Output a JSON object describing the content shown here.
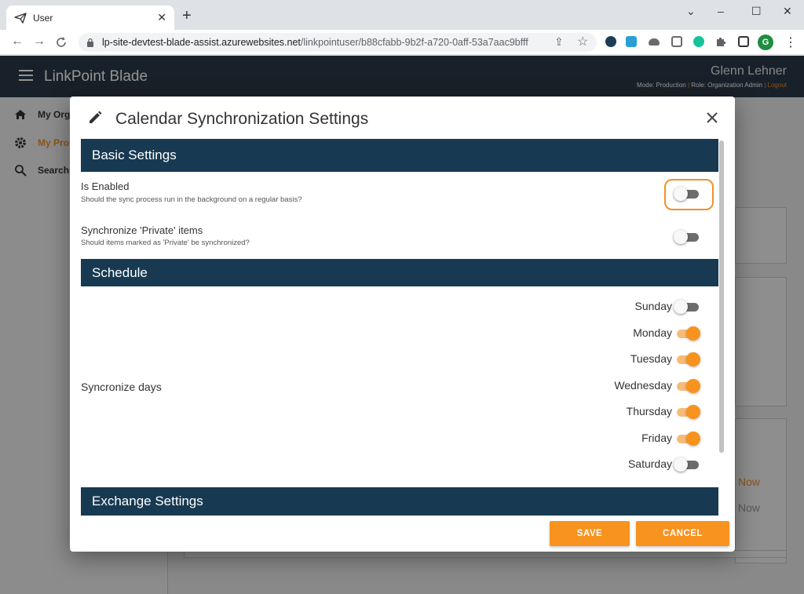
{
  "browser": {
    "tab_title": "User",
    "tab_close": "✕",
    "new_tab": "+",
    "url_host": "lp-site-devtest-blade-assist.azurewebsites.net",
    "url_path": "/linkpointuser/b88cfabb-9b2f-a720-0aff-53a7aac9bfff",
    "profile_initial": "G",
    "window_controls": [
      "⌄",
      "–",
      "☐",
      "✕"
    ],
    "nav": [
      "←",
      "→",
      "C"
    ],
    "toolbar_icons": [
      "⇪",
      "☆",
      "⋮"
    ]
  },
  "app": {
    "title": "LinkPoint Blade",
    "user_name": "Glenn Lehner",
    "user_meta_mode": "Mode: Production",
    "user_meta_sep": "|",
    "user_meta_role": "Role: Organization Admin",
    "user_meta_logout": "Logout"
  },
  "sidebar": {
    "items": [
      {
        "label": "My Orga",
        "icon": "home-icon",
        "active": false
      },
      {
        "label": "My Prof",
        "icon": "gear-icon",
        "active": true
      },
      {
        "label": "Search",
        "icon": "search-icon",
        "active": false
      }
    ]
  },
  "background": {
    "now_labels": [
      "Now",
      "Now"
    ]
  },
  "dialog": {
    "title": "Calendar Synchronization Settings",
    "icon": "pencil-icon",
    "sections": {
      "basic": "Basic Settings",
      "schedule": "Schedule",
      "exchange": "Exchange Settings"
    },
    "settings": {
      "is_enabled": {
        "label": "Is Enabled",
        "description": "Should the sync process run in the background on a regular basis?",
        "on": false
      },
      "sync_private": {
        "label": "Synchronize 'Private' items",
        "description": "Should items marked as 'Private' be synchronized?",
        "on": false
      }
    },
    "sync_days_label": "Syncronize days",
    "days": [
      {
        "label": "Sunday",
        "on": false
      },
      {
        "label": "Monday",
        "on": true
      },
      {
        "label": "Tuesday",
        "on": true
      },
      {
        "label": "Wednesday",
        "on": true
      },
      {
        "label": "Thursday",
        "on": true
      },
      {
        "label": "Friday",
        "on": true
      },
      {
        "label": "Saturday",
        "on": false
      }
    ],
    "buttons": {
      "save": "SAVE",
      "cancel": "CANCEL"
    }
  },
  "colors": {
    "accent": "#f7931e",
    "header": "#2a3a47",
    "section": "#173a52"
  }
}
